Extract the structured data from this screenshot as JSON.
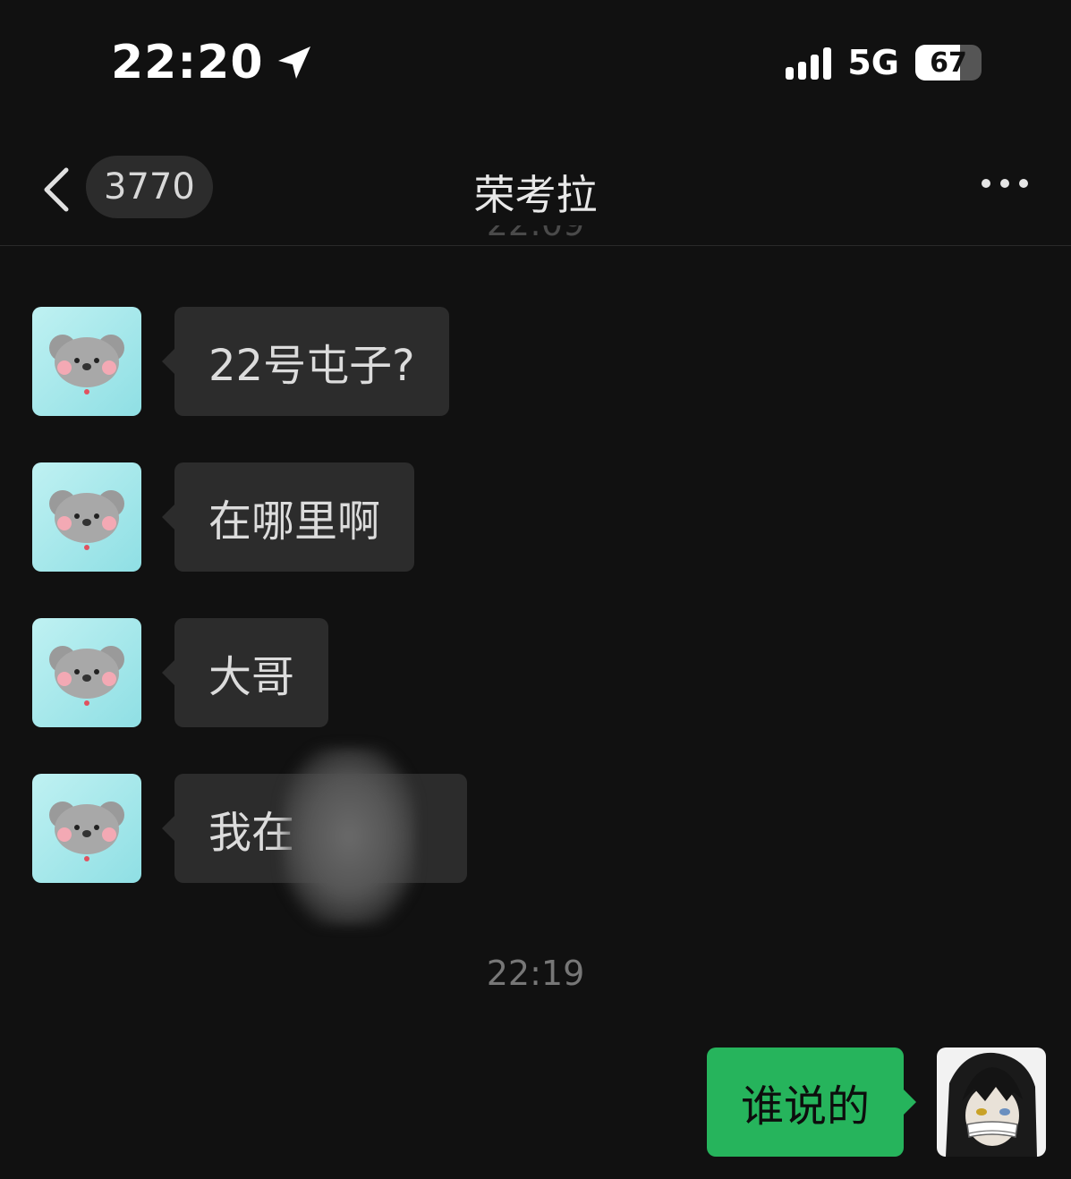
{
  "status_bar": {
    "time": "22:20",
    "network": "5G",
    "battery_percent": "67",
    "battery_level": 0.67,
    "signal_bars": 4
  },
  "nav": {
    "unread_count": "3770",
    "title": "荣考拉"
  },
  "messages_in": [
    {
      "text": "22号屯子?"
    },
    {
      "text": "在哪里啊"
    },
    {
      "text": "大哥"
    },
    {
      "text": "我在"
    }
  ],
  "time_separator": "22:19",
  "message_out": {
    "text": "谁说的"
  },
  "colors": {
    "background": "#111111",
    "incoming_bubble": "#2c2c2c",
    "outgoing_bubble": "#26b45c"
  },
  "icons": [
    "location-arrow-icon",
    "signal-icon",
    "battery-icon",
    "back-chevron-icon",
    "more-dots-icon",
    "koala-avatar",
    "anime-avatar"
  ]
}
